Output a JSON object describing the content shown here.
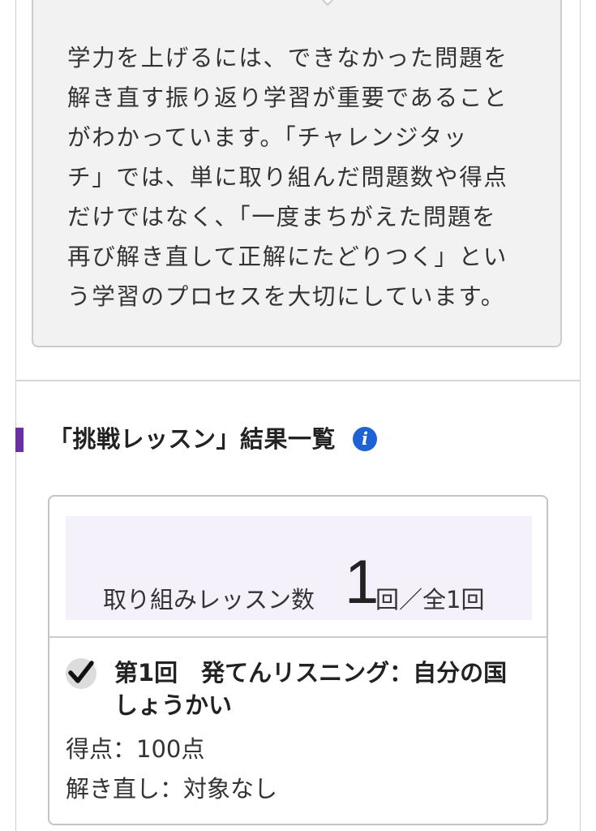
{
  "info": {
    "text": "学力を上げるには、できなかった問題を\n解き直す振り返り学習が重要であること\nがわかっています。「チャレンジタッ\nチ」では、単に取り組んだ問題数や得点\nだけではなく、「一度まちがえた問題を\n再び解き直して正解にたどりつく」とい\nう学習のプロセスを大切にしています。"
  },
  "section": {
    "title": "「挑戦レッスン」結果一覧",
    "info_icon": "i",
    "marker_color": "#6a2fa6",
    "icon_color": "#1e63d6"
  },
  "summary": {
    "label": "取り組みレッスン数",
    "count": "1",
    "total": "回／全1回",
    "band_color": "#f4f1fb"
  },
  "lessons": [
    {
      "icon": "checkmark-icon",
      "completed": true,
      "title": "第1回　発てんリスニング：自分の国しょうかい",
      "score": "得点：100点",
      "retry": "解き直し：対象なし"
    }
  ]
}
